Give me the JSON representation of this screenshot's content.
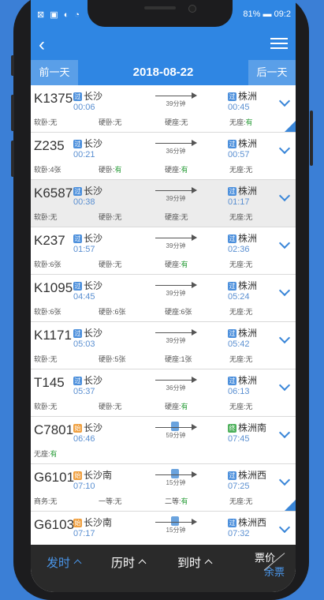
{
  "status": {
    "left_icons": "⊠ ▣ ◐ ◔",
    "battery": "81%",
    "time": "09:2"
  },
  "nav": {
    "back_icon": "‹",
    "menu_icon": "list-menu-icon"
  },
  "datebar": {
    "prev_label": "前一天",
    "date": "2018-08-22",
    "next_label": "后一天"
  },
  "trains": [
    {
      "no": "K1375",
      "from": "长沙",
      "from_badge": "过",
      "from_time": "00:06",
      "to": "株洲",
      "to_badge": "过",
      "to_time": "00:45",
      "duration": "39分钟",
      "badge_color": "blue",
      "seats": [
        {
          "label": "软卧:",
          "val": "无",
          "avail": false
        },
        {
          "label": "硬卧:",
          "val": "无",
          "avail": false
        },
        {
          "label": "硬座:",
          "val": "无",
          "avail": false
        },
        {
          "label": "无座:",
          "val": "有",
          "avail": true
        }
      ],
      "corner": true
    },
    {
      "no": "Z235",
      "from": "长沙",
      "from_badge": "过",
      "from_time": "00:21",
      "to": "株洲",
      "to_badge": "过",
      "to_time": "00:57",
      "duration": "36分钟",
      "badge_color": "blue",
      "seats": [
        {
          "label": "软卧:",
          "val": "4张",
          "avail": false
        },
        {
          "label": "硬卧:",
          "val": "有",
          "avail": true
        },
        {
          "label": "硬座:",
          "val": "有",
          "avail": true
        },
        {
          "label": "无座:",
          "val": "无",
          "avail": false
        }
      ],
      "corner": false
    },
    {
      "no": "K6587",
      "from": "长沙",
      "from_badge": "过",
      "from_time": "00:38",
      "to": "株洲",
      "to_badge": "过",
      "to_time": "01:17",
      "duration": "39分钟",
      "badge_color": "blue",
      "seats": [
        {
          "label": "软卧:",
          "val": "无",
          "avail": false
        },
        {
          "label": "硬卧:",
          "val": "无",
          "avail": false
        },
        {
          "label": "硬座:",
          "val": "无",
          "avail": false
        },
        {
          "label": "无座:",
          "val": "无",
          "avail": false
        }
      ],
      "corner": false,
      "highlight": true
    },
    {
      "no": "K237",
      "from": "长沙",
      "from_badge": "过",
      "from_time": "01:57",
      "to": "株洲",
      "to_badge": "过",
      "to_time": "02:36",
      "duration": "39分钟",
      "badge_color": "blue",
      "seats": [
        {
          "label": "软卧:",
          "val": "6张",
          "avail": false
        },
        {
          "label": "硬卧:",
          "val": "无",
          "avail": false
        },
        {
          "label": "硬座:",
          "val": "有",
          "avail": true
        },
        {
          "label": "无座:",
          "val": "无",
          "avail": false
        }
      ],
      "corner": false
    },
    {
      "no": "K1095",
      "from": "长沙",
      "from_badge": "过",
      "from_time": "04:45",
      "to": "株洲",
      "to_badge": "过",
      "to_time": "05:24",
      "duration": "39分钟",
      "badge_color": "blue",
      "seats": [
        {
          "label": "软卧:",
          "val": "6张",
          "avail": false
        },
        {
          "label": "硬卧:",
          "val": "6张",
          "avail": false
        },
        {
          "label": "硬座:",
          "val": "6张",
          "avail": false
        },
        {
          "label": "无座:",
          "val": "无",
          "avail": false
        }
      ],
      "corner": false
    },
    {
      "no": "K1171",
      "from": "长沙",
      "from_badge": "过",
      "from_time": "05:03",
      "to": "株洲",
      "to_badge": "过",
      "to_time": "05:42",
      "duration": "39分钟",
      "badge_color": "blue",
      "seats": [
        {
          "label": "软卧:",
          "val": "无",
          "avail": false
        },
        {
          "label": "硬卧:",
          "val": "5张",
          "avail": false
        },
        {
          "label": "硬座:",
          "val": "1张",
          "avail": false
        },
        {
          "label": "无座:",
          "val": "无",
          "avail": false
        }
      ],
      "corner": false
    },
    {
      "no": "T145",
      "from": "长沙",
      "from_badge": "过",
      "from_time": "05:37",
      "to": "株洲",
      "to_badge": "过",
      "to_time": "06:13",
      "duration": "36分钟",
      "badge_color": "blue",
      "seats": [
        {
          "label": "软卧:",
          "val": "无",
          "avail": false
        },
        {
          "label": "硬卧:",
          "val": "无",
          "avail": false
        },
        {
          "label": "硬座:",
          "val": "有",
          "avail": true
        },
        {
          "label": "无座:",
          "val": "无",
          "avail": false
        }
      ],
      "corner": false
    },
    {
      "no": "C7801",
      "from": "长沙",
      "from_badge": "始",
      "from_time": "06:46",
      "to": "株洲南",
      "to_badge": "终",
      "to_time": "07:45",
      "duration": "59分钟",
      "badge_color": "orange",
      "seats": [
        {
          "label": "无座:",
          "val": "有",
          "avail": true
        }
      ],
      "corner": false
    },
    {
      "no": "G6101",
      "from": "长沙南",
      "from_badge": "始",
      "from_time": "07:10",
      "to": "株洲西",
      "to_badge": "过",
      "to_time": "07:25",
      "duration": "15分钟",
      "badge_color": "orange",
      "seats": [
        {
          "label": "商务:",
          "val": "无",
          "avail": false
        },
        {
          "label": "一等:",
          "val": "无",
          "avail": false
        },
        {
          "label": "二等:",
          "val": "有",
          "avail": true
        },
        {
          "label": "无座:",
          "val": "无",
          "avail": false
        }
      ],
      "corner": true
    },
    {
      "no": "G6103",
      "from": "长沙南",
      "from_badge": "始",
      "from_time": "07:17",
      "to": "株洲西",
      "to_badge": "过",
      "to_time": "07:32",
      "duration": "15分钟",
      "badge_color": "orange",
      "seats": [],
      "corner": false
    }
  ],
  "tabs": {
    "depart": "发时",
    "duration": "历时",
    "arrive": "到时",
    "fare_top": "票价",
    "fare_bottom": "余票"
  }
}
